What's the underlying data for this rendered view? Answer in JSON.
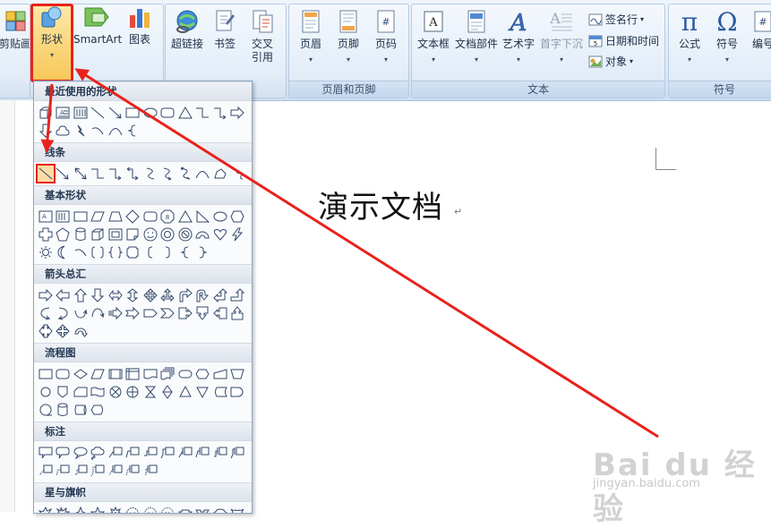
{
  "ribbon": {
    "clipboard": {
      "paste_label": "剪贴画"
    },
    "illustrations": {
      "shapes_label": "形状",
      "smartart_label": "SmartArt",
      "chart_label": "图表"
    },
    "links": {
      "hyperlink_label": "超链接",
      "bookmark_label": "书签",
      "crossref_label_1": "交叉",
      "crossref_label_2": "引用"
    },
    "header_footer": {
      "header_label": "页眉",
      "footer_label": "页脚",
      "pagenum_label": "页码",
      "group_label": "页眉和页脚"
    },
    "text": {
      "textbox_label": "文本框",
      "parts_label": "文档部件",
      "wordart_label": "艺术字",
      "dropcap_label": "首字下沉",
      "signature_label": "签名行",
      "datetime_label": "日期和时间",
      "object_label": "对象",
      "group_label": "文本"
    },
    "symbols": {
      "formula_label": "公式",
      "symbol_label": "符号",
      "number_label": "编号",
      "group_label": "符号"
    }
  },
  "shapes_menu": {
    "sections": [
      {
        "title": "最近使用的形状"
      },
      {
        "title": "线条"
      },
      {
        "title": "基本形状"
      },
      {
        "title": "箭头总汇"
      },
      {
        "title": "流程图"
      },
      {
        "title": "标注"
      },
      {
        "title": "星与旗帜"
      }
    ]
  },
  "document": {
    "title": "演示文档",
    "para_mark": "↵"
  },
  "watermark": {
    "brand": "Bai du 经验",
    "url": "jingyan.baidu.com"
  },
  "colors": {
    "highlight_red": "#e8221b",
    "ribbon_blue": "#dfeaf7"
  }
}
